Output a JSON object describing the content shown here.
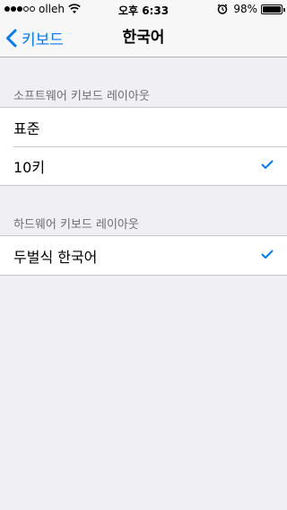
{
  "status_bar": {
    "carrier": "olleh",
    "time": "오후 6:33",
    "battery_pct": "98%",
    "battery_level": 0.98,
    "signal_bars_filled": 3,
    "signal_bars_total": 5
  },
  "nav": {
    "back_label": "키보드",
    "title": "한국어"
  },
  "sections": [
    {
      "header": "소프트웨어 키보드 레이아웃",
      "rows": [
        {
          "label": "표준",
          "checked": false
        },
        {
          "label": "10키",
          "checked": true
        }
      ]
    },
    {
      "header": "하드웨어 키보드 레이아웃",
      "rows": [
        {
          "label": "두벌식 한국어",
          "checked": true
        }
      ]
    }
  ],
  "colors": {
    "accent": "#007aff",
    "background": "#efeff4",
    "section_header_text": "#6d6d72"
  },
  "icons": {
    "back": "chevron-left-icon",
    "check": "checkmark-icon",
    "wifi": "wifi-icon",
    "alarm": "alarm-clock-icon",
    "battery": "battery-icon"
  }
}
